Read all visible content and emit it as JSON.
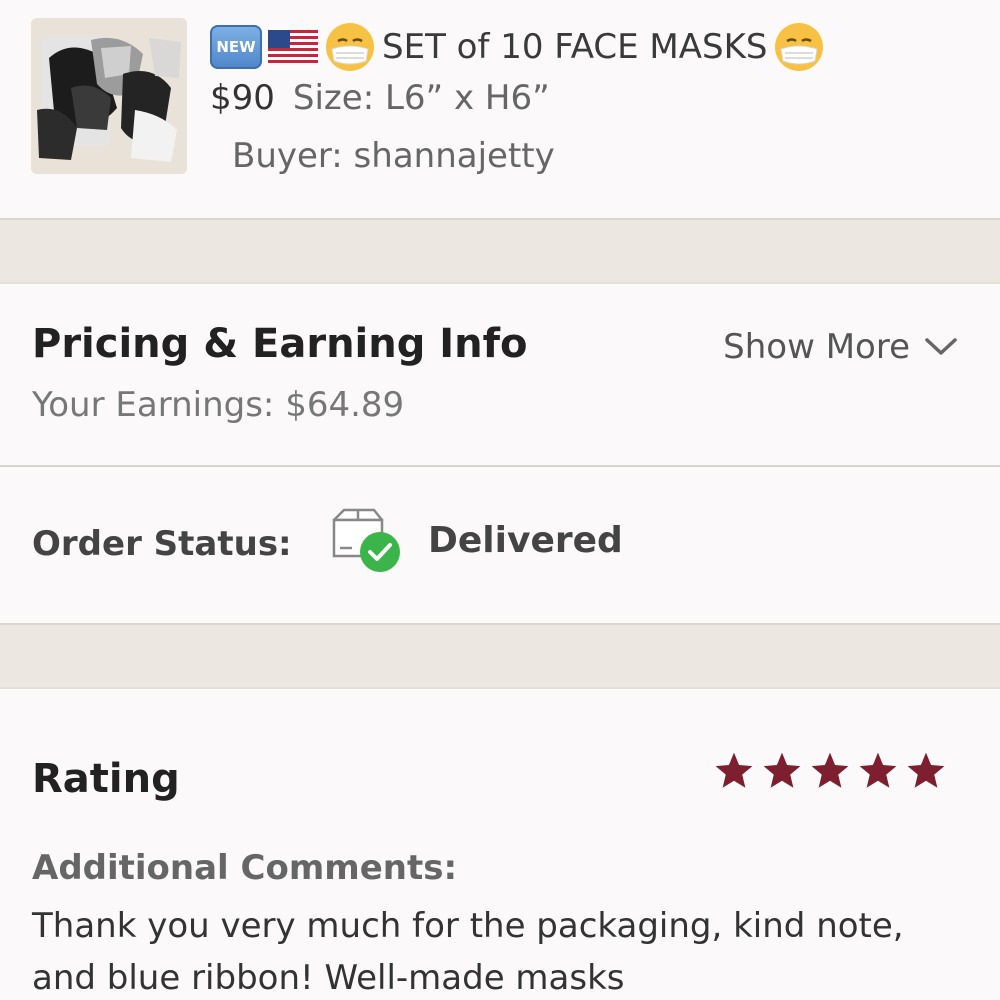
{
  "product": {
    "badge": "NEW",
    "title": "SET of 10 FACE MASKS",
    "price": "$90",
    "size": "Size: L6” x H6”",
    "buyer": "Buyer: shannajetty"
  },
  "pricing": {
    "title": "Pricing & Earning Info",
    "earnings": "Your Earnings: $64.89",
    "show_more": "Show More"
  },
  "order_status": {
    "label": "Order Status:",
    "value": "Delivered",
    "icon": "delivered-box-icon"
  },
  "rating": {
    "title": "Rating",
    "stars": 5,
    "max_stars": 5,
    "comments_label": "Additional Comments:",
    "comments": "Thank you very much for the packaging, kind note, and blue ribbon! Well-made masks"
  },
  "colors": {
    "star": "#7d1f2f",
    "check_green": "#3bb54a",
    "separator": "#ece8e1"
  }
}
